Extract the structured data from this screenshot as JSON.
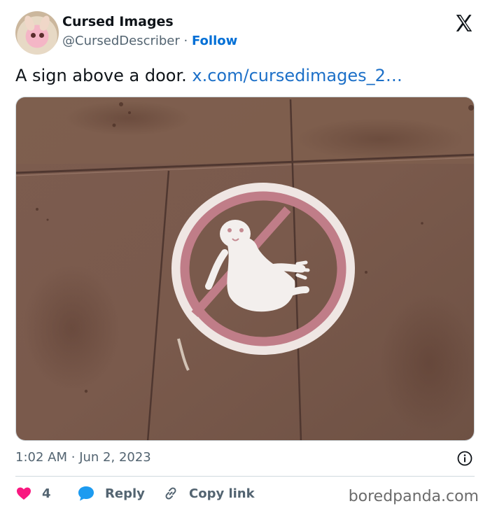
{
  "author": {
    "display_name": "Cursed Images",
    "handle": "@CursedDescriber",
    "separator": "·",
    "follow_label": "Follow"
  },
  "tweet": {
    "text": "A sign above a door.",
    "link_text": "x.com/cursedimages_2…"
  },
  "meta": {
    "time": "1:02 AM",
    "separator": "·",
    "date": "Jun 2, 2023"
  },
  "actions": {
    "likes_count": "4",
    "reply_label": "Reply",
    "copy_link_label": "Copy link"
  },
  "watermark": "boredpanda.com",
  "colors": {
    "like": "#f91880",
    "reply": "#1d9bf0",
    "follow": "#006fd6",
    "link": "#1d70c8"
  },
  "icons": {
    "brand": "x-logo-icon",
    "info": "info-icon",
    "like": "heart-icon",
    "reply": "reply-bubble-icon",
    "copy": "link-icon"
  }
}
